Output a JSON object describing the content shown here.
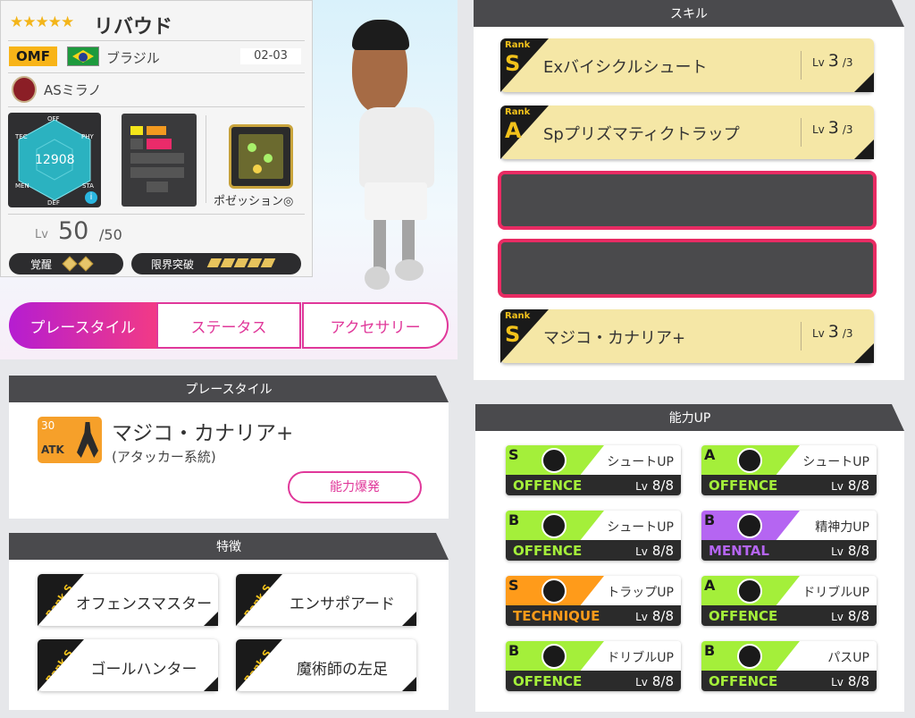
{
  "colors": {
    "accent": "#e0389a",
    "gold": "#f3c21b",
    "offence": "#a4ef3a",
    "mental": "#b565f2",
    "technique": "#ff9b1a"
  },
  "player": {
    "stars": "★★★★★",
    "name": "リバウド",
    "position": "OMF",
    "country": "ブラジル",
    "season": "02-03",
    "club": "ASミラノ",
    "rating": "12908",
    "radar_labels": [
      "OFF",
      "PHY",
      "STA",
      "DEF",
      "MEN",
      "TEC"
    ],
    "play_category": "ポゼッション◎",
    "lv_label": "Lv",
    "lv_value": "50",
    "lv_max": "/50",
    "awaken_label": "覚醒",
    "limit_label": "限界突破"
  },
  "tabs": {
    "playstyle": "プレースタイル",
    "status": "ステータス",
    "accessory": "アクセサリー"
  },
  "playstyle_panel": {
    "header": "プレースタイル",
    "icon_num": "30",
    "icon_cat": "ATK",
    "name": "マジコ・カナリア+",
    "sub": "(アタッカー系統)",
    "button": "能力爆発"
  },
  "traits_panel": {
    "header": "特徴",
    "rank_label": "Rank S",
    "items": [
      "オフェンスマスター",
      "エンサポアード",
      "ゴールハンター",
      "魔術師の左足"
    ]
  },
  "skills_panel": {
    "header": "スキル",
    "rank_word": "Rank",
    "lv_word": "Lv",
    "items": [
      {
        "rank": "S",
        "name": "Exバイシクルシュート",
        "lv": "3",
        "max": "/3"
      },
      {
        "rank": "A",
        "name": "Spプリズマティクトラップ",
        "lv": "3",
        "max": "/3"
      },
      {
        "rank": "S",
        "name": "マジコ・カナリア+",
        "lv": "3",
        "max": "/3"
      }
    ]
  },
  "ability_panel": {
    "header": "能力UP",
    "lv_word": "Lv",
    "items": [
      {
        "rank": "S",
        "name": "シュートUP",
        "cat": "OFFENCE",
        "lv": "8/8"
      },
      {
        "rank": "A",
        "name": "シュートUP",
        "cat": "OFFENCE",
        "lv": "8/8"
      },
      {
        "rank": "B",
        "name": "シュートUP",
        "cat": "OFFENCE",
        "lv": "8/8"
      },
      {
        "rank": "B",
        "name": "精神力UP",
        "cat": "MENTAL",
        "lv": "8/8"
      },
      {
        "rank": "S",
        "name": "トラップUP",
        "cat": "TECHNIQUE",
        "lv": "8/8"
      },
      {
        "rank": "A",
        "name": "ドリブルUP",
        "cat": "OFFENCE",
        "lv": "8/8"
      },
      {
        "rank": "B",
        "name": "ドリブルUP",
        "cat": "OFFENCE",
        "lv": "8/8"
      },
      {
        "rank": "B",
        "name": "パスUP",
        "cat": "OFFENCE",
        "lv": "8/8"
      }
    ]
  }
}
